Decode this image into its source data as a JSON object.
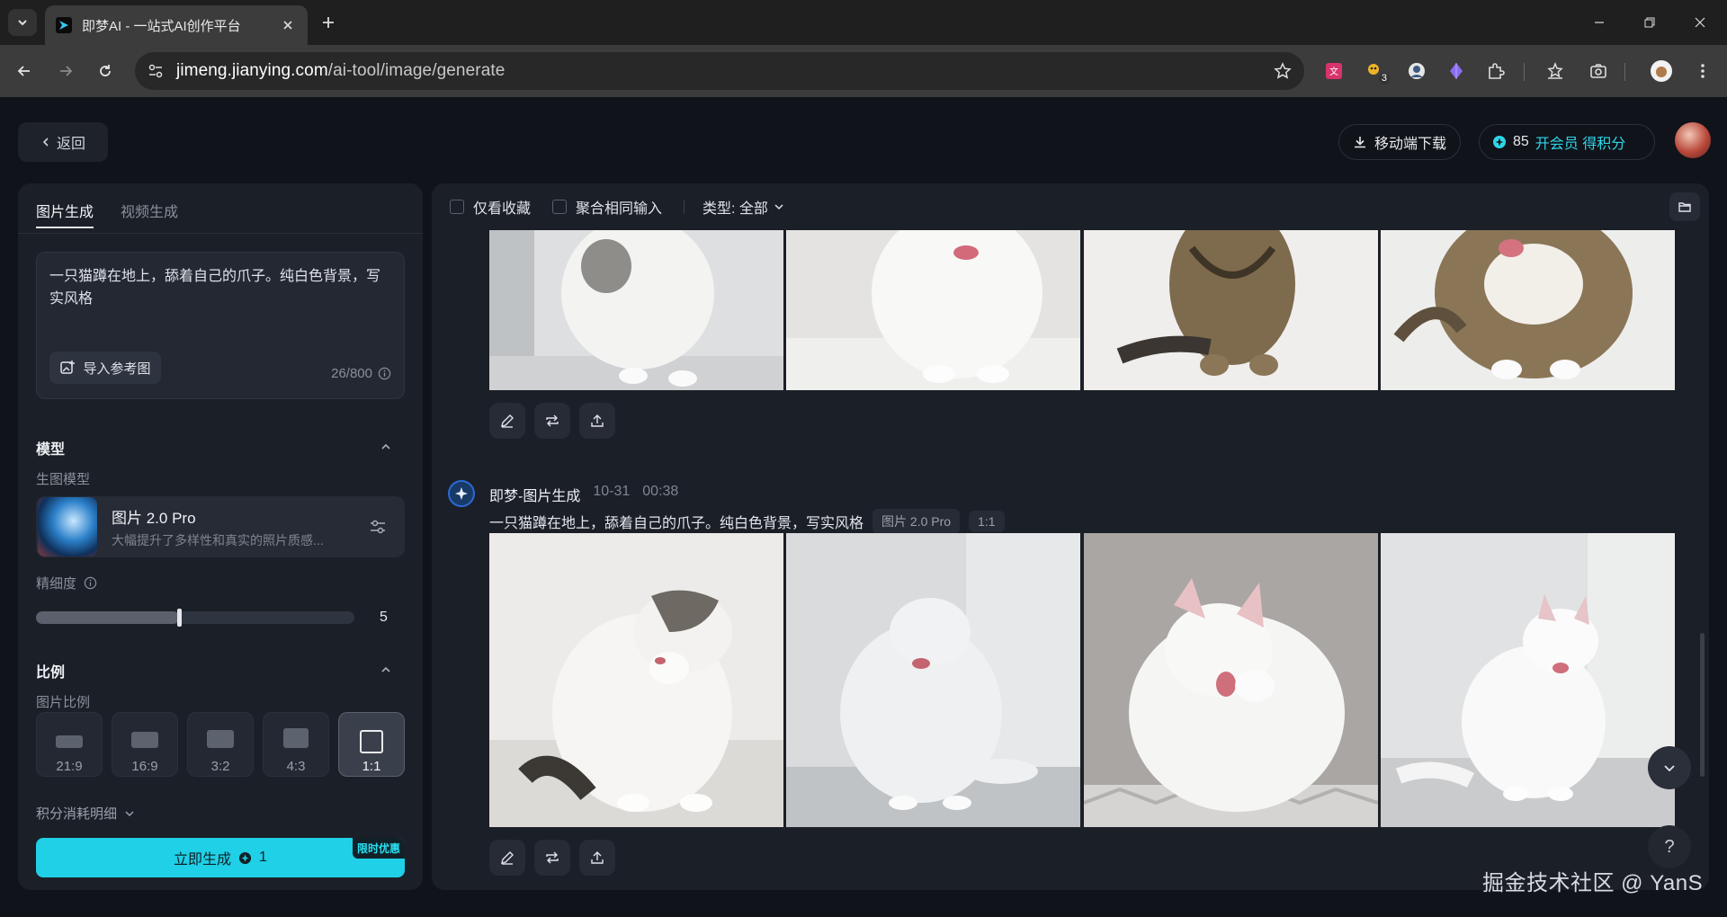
{
  "browser": {
    "tab_title": "即梦AI - 一站式AI创作平台",
    "url_host": "jimeng.jianying.com",
    "url_path": "/ai-tool/image/generate",
    "extension_badge": "3"
  },
  "header": {
    "back_label": "返回",
    "mobile_download_label": "移动端下载",
    "credits_value": "85",
    "vip_label": "开会员 得积分"
  },
  "left_panel": {
    "tabs": [
      "图片生成",
      "视频生成"
    ],
    "prompt_text": "一只猫蹲在地上，舔着自己的爪子。纯白色背景，写实风格",
    "ref_image_label": "导入参考图",
    "char_count": "26/800",
    "model_section_title": "模型",
    "model_sub_label": "生图模型",
    "model_name": "图片 2.0 Pro",
    "model_desc": "大幅提升了多样性和真实的照片质感...",
    "detail_label": "精细度",
    "detail_value": "5",
    "detail_level_fraction": 0.45,
    "ratio_section_title": "比例",
    "ratio_sub_label": "图片比例",
    "ratios": [
      "21:9",
      "16:9",
      "3:2",
      "4:3",
      "1:1"
    ],
    "selected_ratio": "1:1",
    "cost_detail_label": "积分消耗明细",
    "generate_label": "立即生成",
    "generate_cost": "1",
    "promo_tag": "限时优惠"
  },
  "right_panel": {
    "filter_favorites": "仅看收藏",
    "filter_merge": "聚合相同输入",
    "filter_type": "类型: 全部",
    "message": {
      "sender": "即梦-图片生成",
      "date": "10-31",
      "time": "00:38",
      "prompt": "一只猫蹲在地上，舔着自己的爪子。纯白色背景，写实风格",
      "model_tag": "图片 2.0 Pro",
      "ratio_tag": "1:1"
    },
    "help_label": "?"
  },
  "watermark": "掘金技术社区 @ YanS",
  "colors": {
    "accent": "#1fd0e6",
    "page_bg": "#10131a",
    "panel_bg": "#1b1f27"
  }
}
